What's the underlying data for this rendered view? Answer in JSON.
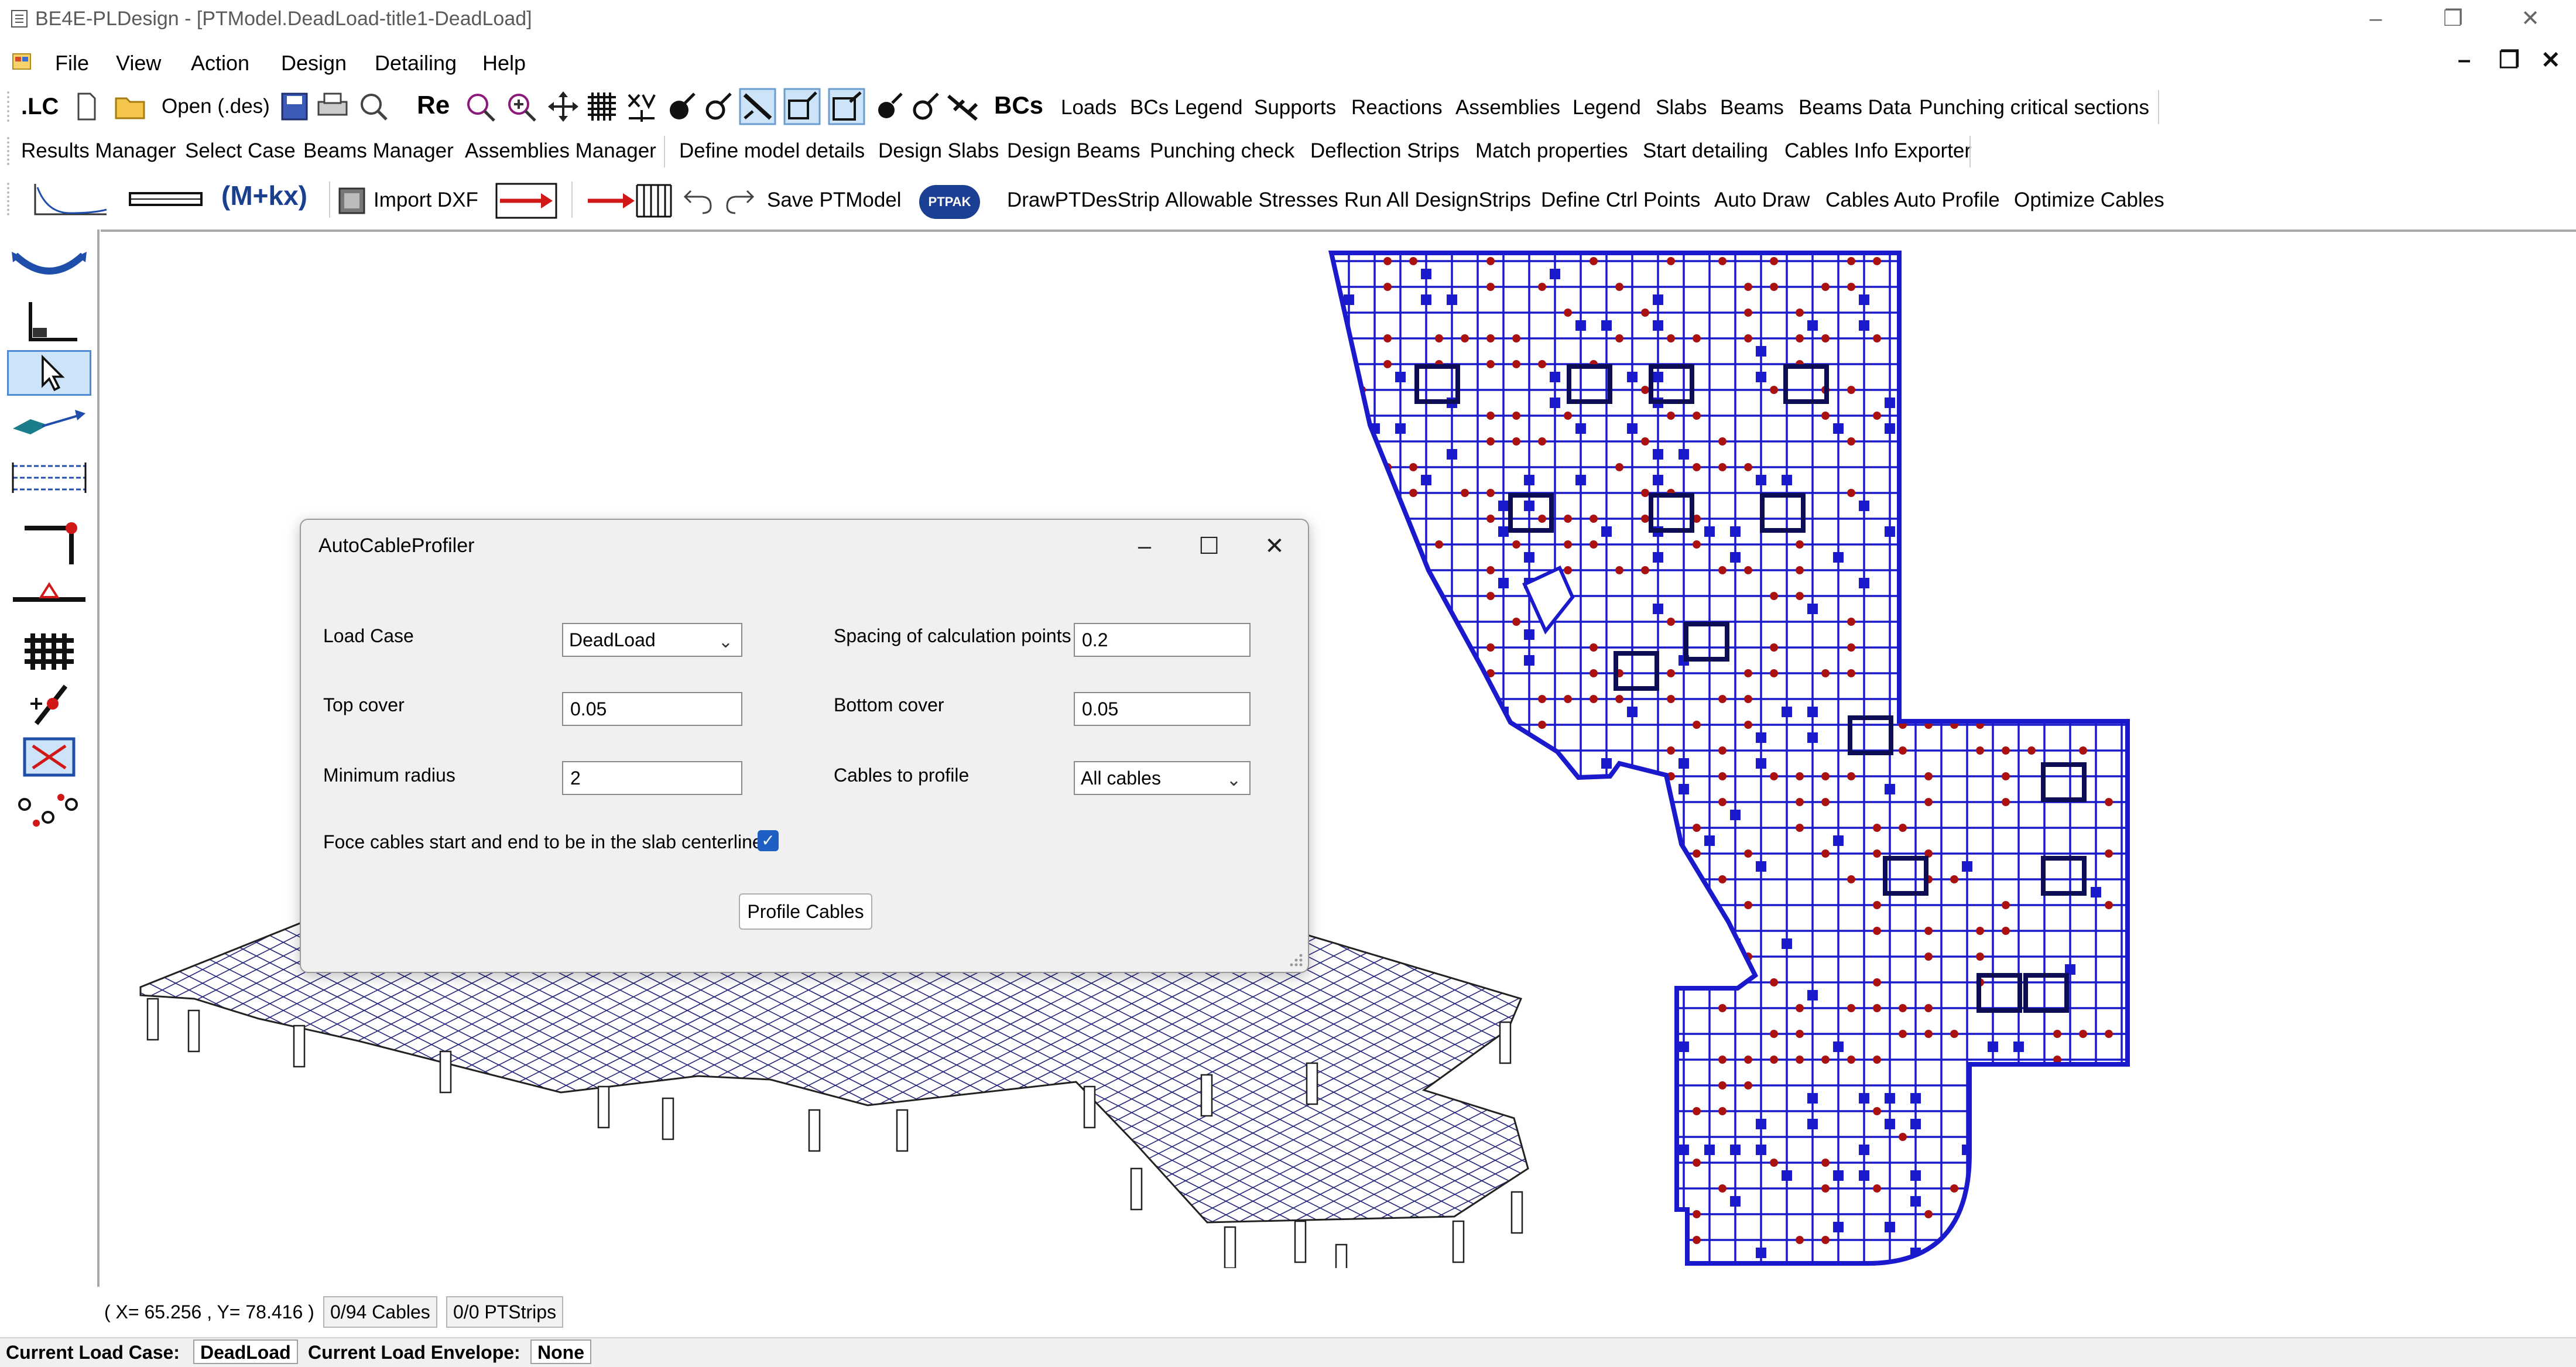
{
  "window": {
    "title": "BE4E-PLDesign - [PTModel.DeadLoad-title1-DeadLoad]",
    "minimize": "–",
    "restore": "❐",
    "close": "✕"
  },
  "menu": {
    "items": [
      "File",
      "View",
      "Action",
      "Design",
      "Detailing",
      "Help"
    ],
    "mdi_minimize": "–",
    "mdi_restore": "❐",
    "mdi_close": "✕"
  },
  "toolbar1": {
    "lc": ".LC",
    "open": "Open (.des)",
    "re": "Re",
    "bcs": "BCs",
    "items": [
      "Loads",
      "BCs Legend",
      "Supports",
      "Reactions",
      "Assemblies",
      "Legend",
      "Slabs",
      "Beams",
      "Beams Data",
      "Punching critical sections"
    ]
  },
  "toolbar2": {
    "items": [
      "Results Manager",
      "Select Case",
      "Beams Manager",
      "Assemblies Manager",
      "Define model details",
      "Design Slabs",
      "Design Beams",
      "Punching check",
      "Deflection Strips",
      "Match properties",
      "Start detailing",
      "Cables Info Exporter"
    ]
  },
  "toolbar3": {
    "mkx": "(M+kx)",
    "import_dxf": "Import DXF",
    "save": "Save PTModel",
    "ptpak": "PTPAK",
    "items": [
      "DrawPTDesStrip",
      "Allowable Stresses",
      "Run All DesignStrips",
      "Define Ctrl Points",
      "Auto Draw",
      "Cables Auto Profile",
      "Optimize Cables"
    ]
  },
  "left_tools": [
    "cable-drape-icon",
    "axis-icon",
    "pointer-icon",
    "slab-plane-icon",
    "strip-grid-icon",
    "support-column-icon",
    "line-support-icon",
    "mesh-grid-icon",
    "point-load-icon",
    "opening-icon",
    "control-points-icon"
  ],
  "dialog": {
    "title": "AutoCableProfiler",
    "minimize": "–",
    "maximize": "☐",
    "close": "✕",
    "load_case_label": "Load Case",
    "load_case_value": "DeadLoad",
    "spacing_label": "Spacing of calculation points",
    "spacing_value": "0.2",
    "top_cover_label": "Top cover",
    "top_cover_value": "0.05",
    "bottom_cover_label": "Bottom cover",
    "bottom_cover_value": "0.05",
    "min_radius_label": "Minimum radius",
    "min_radius_value": "2",
    "cables_label": "Cables to profile",
    "cables_value": "All cables",
    "force_label": "Foce cables start and end to be in the slab centerline",
    "force_checked": true,
    "profile_button": "Profile Cables"
  },
  "status": {
    "coords": "( X= 65.256 , Y= 78.416 )",
    "cables": "0/94 Cables",
    "strips": "0/0 PTStrips",
    "load_case_label": "Current Load Case:",
    "load_case_value": "DeadLoad",
    "envelope_label": "Current Load Envelope:",
    "envelope_value": "None"
  },
  "colors": {
    "plan_blue": "#1a1acc",
    "plan_red": "#aa1111",
    "mesh_blue": "#24247a",
    "checkbox_blue": "#1e5fc4"
  }
}
